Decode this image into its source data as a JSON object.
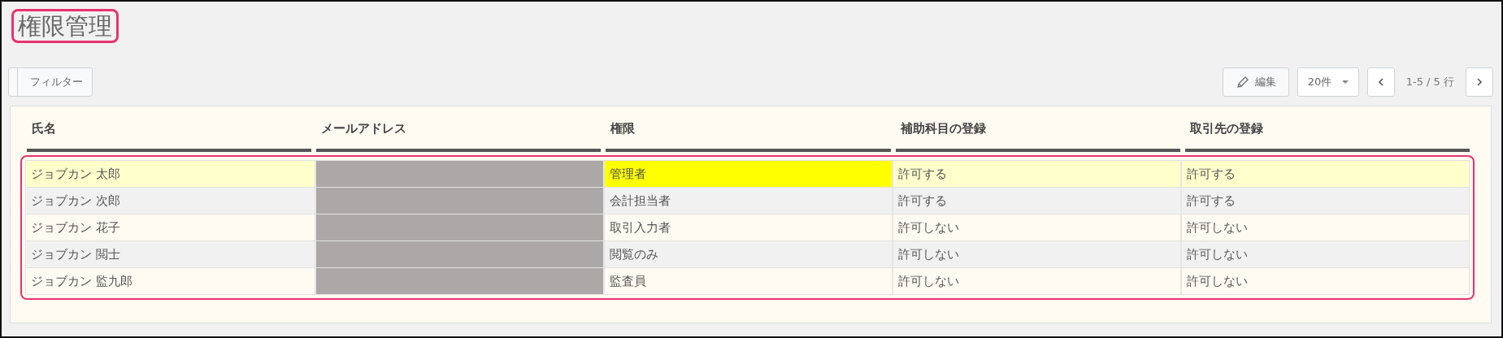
{
  "title": {
    "text": "権限管理",
    "annotated": true
  },
  "toolbar": {
    "filter_button": "フィルター",
    "edit_button": "編集",
    "page_size": "20件",
    "page_info": "1-5 / 5 行"
  },
  "table": {
    "annotated": true,
    "columns": [
      "氏名",
      "メールアドレス",
      "権限",
      "補助科目の登録",
      "取引先の登録"
    ],
    "rows": [
      {
        "name": "ジョブカン 太郎",
        "email_redacted": true,
        "role": "管理者",
        "role_highlighted": true,
        "sub_account": "許可する",
        "partner": "許可する",
        "selected": true
      },
      {
        "name": "ジョブカン 次郎",
        "email_redacted": true,
        "role": "会計担当者",
        "role_highlighted": false,
        "sub_account": "許可する",
        "partner": "許可する",
        "selected": false
      },
      {
        "name": "ジョブカン 花子",
        "email_redacted": true,
        "role": "取引入力者",
        "role_highlighted": false,
        "sub_account": "許可しない",
        "partner": "許可しない",
        "selected": false
      },
      {
        "name": "ジョブカン 閲士",
        "email_redacted": true,
        "role": "閲覧のみ",
        "role_highlighted": false,
        "sub_account": "許可しない",
        "partner": "許可しない",
        "selected": false
      },
      {
        "name": "ジョブカン 監九郎",
        "email_redacted": true,
        "role": "監査員",
        "role_highlighted": false,
        "sub_account": "許可しない",
        "partner": "許可しない",
        "selected": false
      }
    ]
  }
}
